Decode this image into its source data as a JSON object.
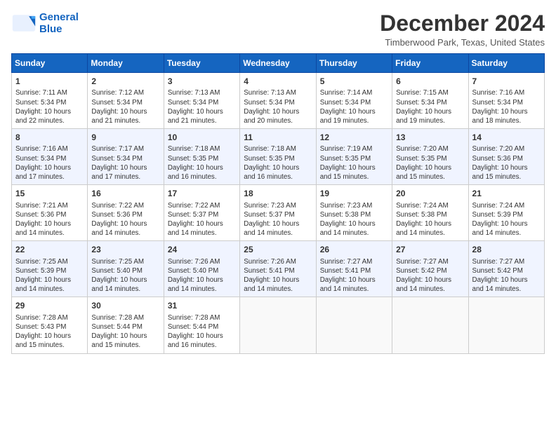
{
  "logo": {
    "line1": "General",
    "line2": "Blue"
  },
  "title": "December 2024",
  "location": "Timberwood Park, Texas, United States",
  "days_of_week": [
    "Sunday",
    "Monday",
    "Tuesday",
    "Wednesday",
    "Thursday",
    "Friday",
    "Saturday"
  ],
  "weeks": [
    [
      {
        "day": "1",
        "info": "Sunrise: 7:11 AM\nSunset: 5:34 PM\nDaylight: 10 hours\nand 22 minutes."
      },
      {
        "day": "2",
        "info": "Sunrise: 7:12 AM\nSunset: 5:34 PM\nDaylight: 10 hours\nand 21 minutes."
      },
      {
        "day": "3",
        "info": "Sunrise: 7:13 AM\nSunset: 5:34 PM\nDaylight: 10 hours\nand 21 minutes."
      },
      {
        "day": "4",
        "info": "Sunrise: 7:13 AM\nSunset: 5:34 PM\nDaylight: 10 hours\nand 20 minutes."
      },
      {
        "day": "5",
        "info": "Sunrise: 7:14 AM\nSunset: 5:34 PM\nDaylight: 10 hours\nand 19 minutes."
      },
      {
        "day": "6",
        "info": "Sunrise: 7:15 AM\nSunset: 5:34 PM\nDaylight: 10 hours\nand 19 minutes."
      },
      {
        "day": "7",
        "info": "Sunrise: 7:16 AM\nSunset: 5:34 PM\nDaylight: 10 hours\nand 18 minutes."
      }
    ],
    [
      {
        "day": "8",
        "info": "Sunrise: 7:16 AM\nSunset: 5:34 PM\nDaylight: 10 hours\nand 17 minutes."
      },
      {
        "day": "9",
        "info": "Sunrise: 7:17 AM\nSunset: 5:34 PM\nDaylight: 10 hours\nand 17 minutes."
      },
      {
        "day": "10",
        "info": "Sunrise: 7:18 AM\nSunset: 5:35 PM\nDaylight: 10 hours\nand 16 minutes."
      },
      {
        "day": "11",
        "info": "Sunrise: 7:18 AM\nSunset: 5:35 PM\nDaylight: 10 hours\nand 16 minutes."
      },
      {
        "day": "12",
        "info": "Sunrise: 7:19 AM\nSunset: 5:35 PM\nDaylight: 10 hours\nand 15 minutes."
      },
      {
        "day": "13",
        "info": "Sunrise: 7:20 AM\nSunset: 5:35 PM\nDaylight: 10 hours\nand 15 minutes."
      },
      {
        "day": "14",
        "info": "Sunrise: 7:20 AM\nSunset: 5:36 PM\nDaylight: 10 hours\nand 15 minutes."
      }
    ],
    [
      {
        "day": "15",
        "info": "Sunrise: 7:21 AM\nSunset: 5:36 PM\nDaylight: 10 hours\nand 14 minutes."
      },
      {
        "day": "16",
        "info": "Sunrise: 7:22 AM\nSunset: 5:36 PM\nDaylight: 10 hours\nand 14 minutes."
      },
      {
        "day": "17",
        "info": "Sunrise: 7:22 AM\nSunset: 5:37 PM\nDaylight: 10 hours\nand 14 minutes."
      },
      {
        "day": "18",
        "info": "Sunrise: 7:23 AM\nSunset: 5:37 PM\nDaylight: 10 hours\nand 14 minutes."
      },
      {
        "day": "19",
        "info": "Sunrise: 7:23 AM\nSunset: 5:38 PM\nDaylight: 10 hours\nand 14 minutes."
      },
      {
        "day": "20",
        "info": "Sunrise: 7:24 AM\nSunset: 5:38 PM\nDaylight: 10 hours\nand 14 minutes."
      },
      {
        "day": "21",
        "info": "Sunrise: 7:24 AM\nSunset: 5:39 PM\nDaylight: 10 hours\nand 14 minutes."
      }
    ],
    [
      {
        "day": "22",
        "info": "Sunrise: 7:25 AM\nSunset: 5:39 PM\nDaylight: 10 hours\nand 14 minutes."
      },
      {
        "day": "23",
        "info": "Sunrise: 7:25 AM\nSunset: 5:40 PM\nDaylight: 10 hours\nand 14 minutes."
      },
      {
        "day": "24",
        "info": "Sunrise: 7:26 AM\nSunset: 5:40 PM\nDaylight: 10 hours\nand 14 minutes."
      },
      {
        "day": "25",
        "info": "Sunrise: 7:26 AM\nSunset: 5:41 PM\nDaylight: 10 hours\nand 14 minutes."
      },
      {
        "day": "26",
        "info": "Sunrise: 7:27 AM\nSunset: 5:41 PM\nDaylight: 10 hours\nand 14 minutes."
      },
      {
        "day": "27",
        "info": "Sunrise: 7:27 AM\nSunset: 5:42 PM\nDaylight: 10 hours\nand 14 minutes."
      },
      {
        "day": "28",
        "info": "Sunrise: 7:27 AM\nSunset: 5:42 PM\nDaylight: 10 hours\nand 14 minutes."
      }
    ],
    [
      {
        "day": "29",
        "info": "Sunrise: 7:28 AM\nSunset: 5:43 PM\nDaylight: 10 hours\nand 15 minutes."
      },
      {
        "day": "30",
        "info": "Sunrise: 7:28 AM\nSunset: 5:44 PM\nDaylight: 10 hours\nand 15 minutes."
      },
      {
        "day": "31",
        "info": "Sunrise: 7:28 AM\nSunset: 5:44 PM\nDaylight: 10 hours\nand 16 minutes."
      },
      {
        "day": "",
        "info": ""
      },
      {
        "day": "",
        "info": ""
      },
      {
        "day": "",
        "info": ""
      },
      {
        "day": "",
        "info": ""
      }
    ]
  ]
}
